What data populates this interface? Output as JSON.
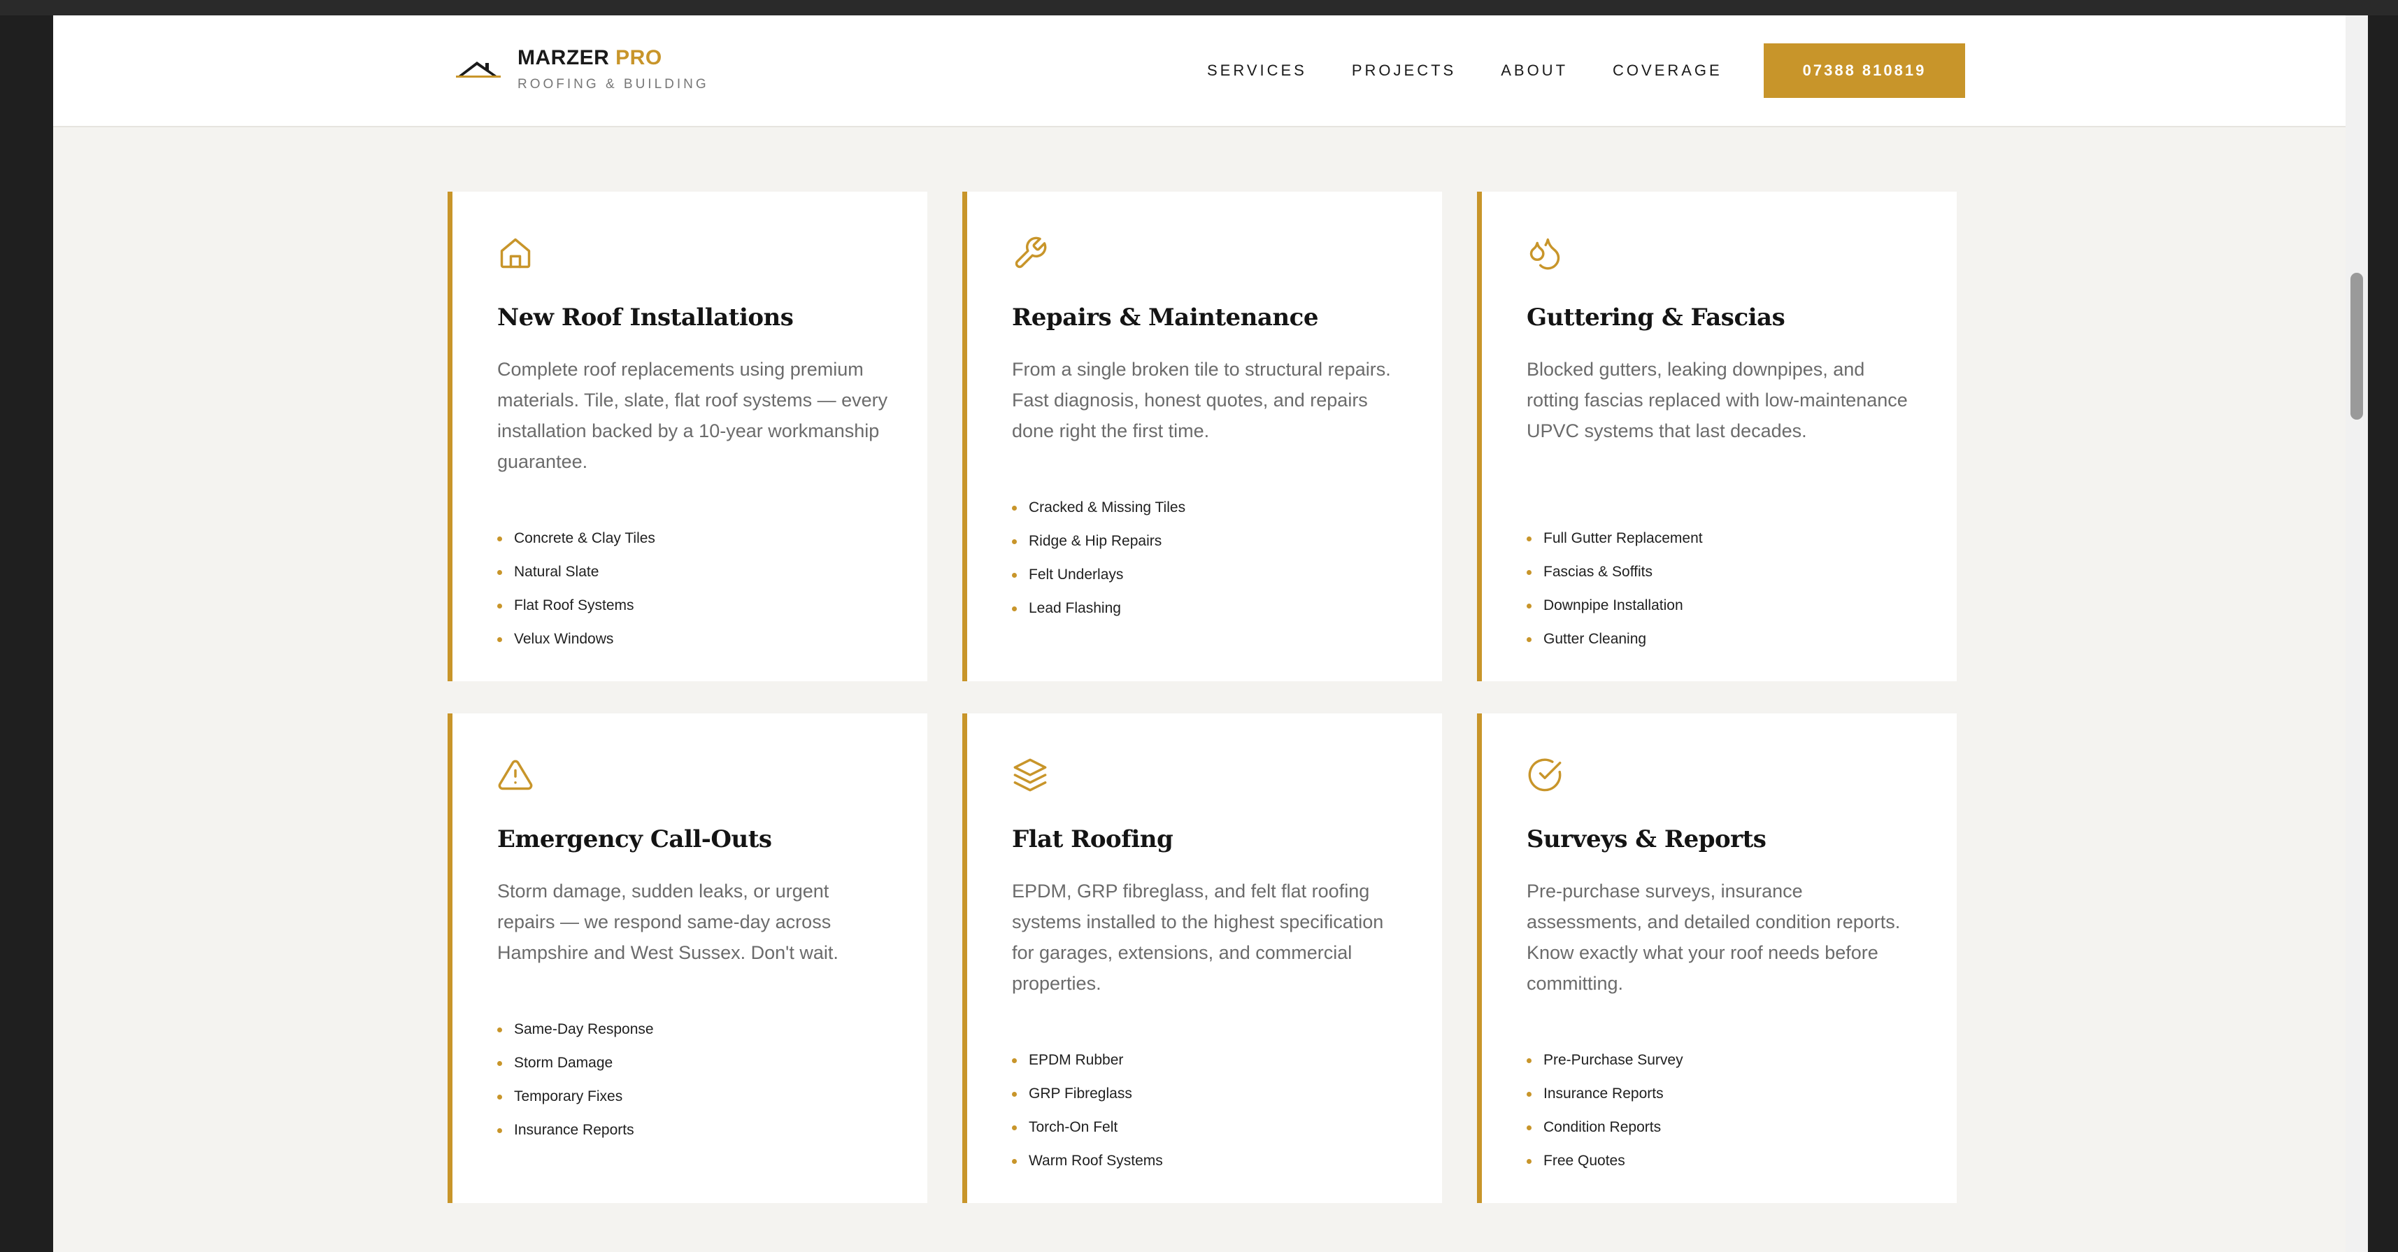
{
  "brand": {
    "name_main": "MARZER",
    "name_accent": "PRO",
    "tagline": "ROOFING & BUILDING",
    "accent_color": "#c8952a"
  },
  "nav": {
    "items": [
      "SERVICES",
      "PROJECTS",
      "ABOUT",
      "COVERAGE"
    ],
    "phone": "07388 810819"
  },
  "services": [
    {
      "icon": "house-icon",
      "title": "New Roof Installations",
      "desc": "Complete roof replacements using premium materials. Tile, slate, flat roof systems — every installation backed by a 10-year workmanship guarantee.",
      "items": [
        "Concrete & Clay Tiles",
        "Natural Slate",
        "Flat Roof Systems",
        "Velux Windows"
      ]
    },
    {
      "icon": "wrench-icon",
      "title": "Repairs & Maintenance",
      "desc": "From a single broken tile to structural repairs. Fast diagnosis, honest quotes, and repairs done right the first time.",
      "items": [
        "Cracked & Missing Tiles",
        "Ridge & Hip Repairs",
        "Felt Underlays",
        "Lead Flashing"
      ]
    },
    {
      "icon": "droplets-icon",
      "title": "Guttering & Fascias",
      "desc": "Blocked gutters, leaking downpipes, and rotting fascias replaced with low-maintenance UPVC systems that last decades.",
      "items": [
        "Full Gutter Replacement",
        "Fascias & Soffits",
        "Downpipe Installation",
        "Gutter Cleaning"
      ]
    },
    {
      "icon": "warning-icon",
      "title": "Emergency Call-Outs",
      "desc": "Storm damage, sudden leaks, or urgent repairs — we respond same-day across Hampshire and West Sussex. Don't wait.",
      "items": [
        "Same-Day Response",
        "Storm Damage",
        "Temporary Fixes",
        "Insurance Reports"
      ]
    },
    {
      "icon": "layers-icon",
      "title": "Flat Roofing",
      "desc": "EPDM, GRP fibreglass, and felt flat roofing systems installed to the highest specification for garages, extensions, and commercial properties.",
      "items": [
        "EPDM Rubber",
        "GRP Fibreglass",
        "Torch-On Felt",
        "Warm Roof Systems"
      ]
    },
    {
      "icon": "check-circle-icon",
      "title": "Surveys & Reports",
      "desc": "Pre-purchase surveys, insurance assessments, and detailed condition reports. Know exactly what your roof needs before committing.",
      "items": [
        "Pre-Purchase Survey",
        "Insurance Reports",
        "Condition Reports",
        "Free Quotes"
      ]
    }
  ]
}
